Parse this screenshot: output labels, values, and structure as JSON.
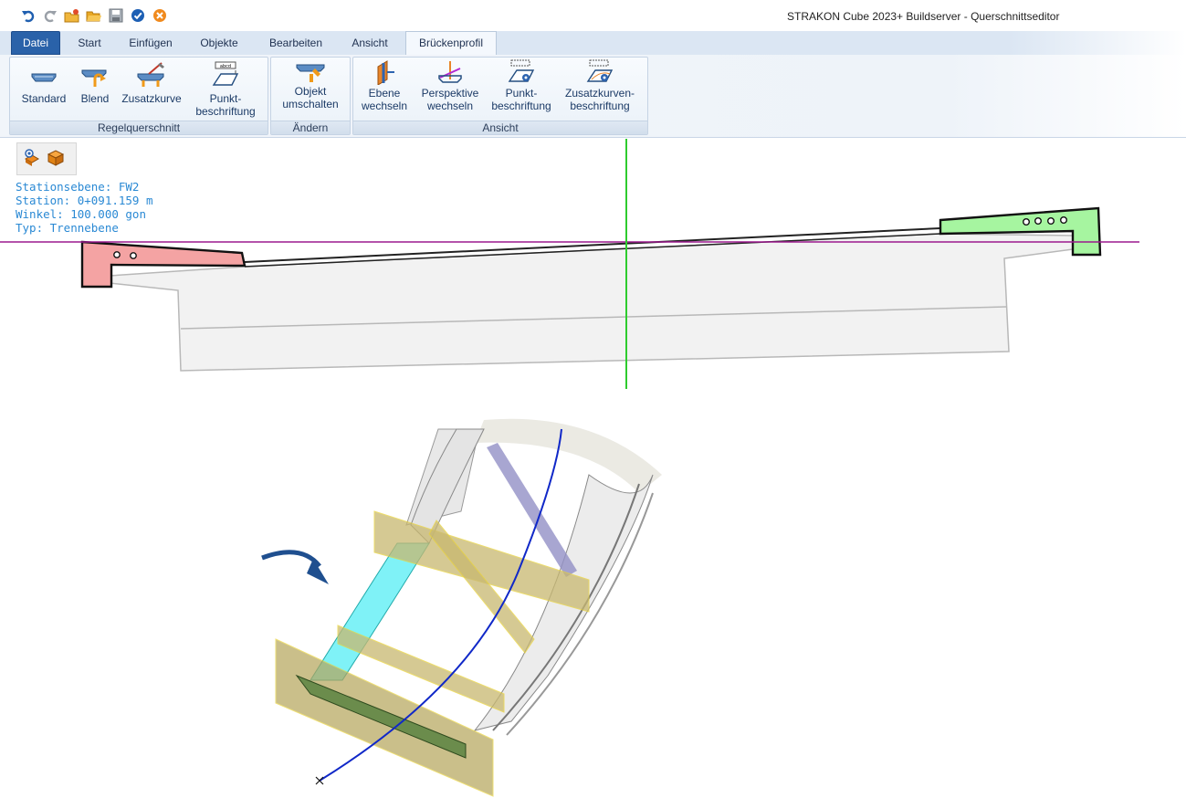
{
  "window": {
    "title": "STRAKON Cube 2023+ Buildserver - Querschnittseditor"
  },
  "quick_access": {
    "icons": [
      "undo-icon",
      "redo-icon",
      "new-file-icon",
      "open-folder-icon",
      "save-icon",
      "confirm-icon",
      "cancel-icon"
    ]
  },
  "tabs": [
    "Datei",
    "Start",
    "Einfügen",
    "Objekte",
    "Bearbeiten",
    "Ansicht",
    "Brückenprofil"
  ],
  "active_tab": "Brückenprofil",
  "ribbon": {
    "groups": [
      {
        "label": "Regelquerschnitt",
        "buttons": [
          "Standard",
          "Blend",
          "Zusatzkurve",
          "Punkt-\nbeschriftung"
        ]
      },
      {
        "label": "Ändern",
        "buttons": [
          "Objekt\numschalten"
        ]
      },
      {
        "label": "Ansicht",
        "buttons": [
          "Ebene\nwechseln",
          "Perspektive\nwechseln",
          "Punkt-\nbeschriftung",
          "Zusatzkurven-\nbeschriftung"
        ]
      }
    ]
  },
  "view_toolbar": {
    "icons": [
      "visibility-toggle-icon",
      "3d-box-icon"
    ]
  },
  "info": {
    "line1": "Stationsebene: FW2",
    "line2": "Station: 0+091.159 m",
    "line3": "Winkel: 100.000 gon",
    "line4": "Typ: Trennebene"
  },
  "colors": {
    "file_tab": "#2a62a9",
    "ribbon_text": "#1b3a66",
    "info_text": "#2a89d4",
    "cap_left": "#f4a3a3",
    "cap_right": "#a6f5a0",
    "axis_vertical": "#2ecc2e",
    "axis_horizontal": "#9b1a8e",
    "plane_yellow": "#c8b870",
    "cyan_face": "#7ff2f7",
    "curve_blue": "#1028c8"
  }
}
